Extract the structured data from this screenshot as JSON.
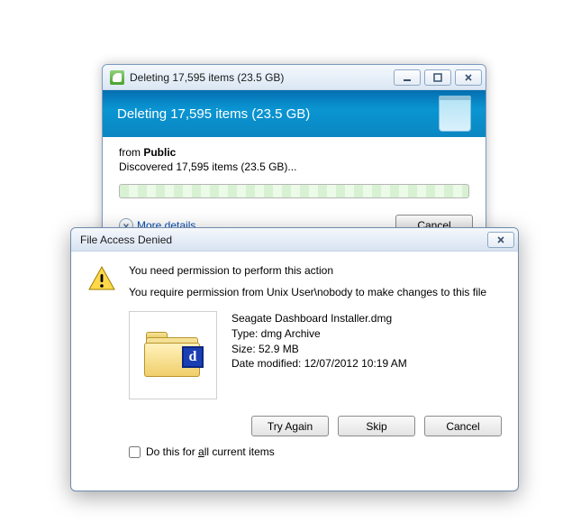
{
  "delete_dialog": {
    "title": "Deleting 17,595 items (23.5 GB)",
    "header": "Deleting 17,595 items (23.5 GB)",
    "from_prefix": "from ",
    "from_target": "Public",
    "discovered": "Discovered 17,595 items (23.5 GB)...",
    "more_details": "More details",
    "cancel": "Cancel"
  },
  "deny_dialog": {
    "title": "File Access Denied",
    "need_permission": "You need permission to perform this action",
    "require_permission": "You require permission from Unix User\\nobody to make changes to this file",
    "file": {
      "name": "Seagate Dashboard Installer.dmg",
      "type_line": "Type: dmg Archive",
      "size_line": "Size: 52.9 MB",
      "date_line": "Date modified: 12/07/2012 10:19 AM"
    },
    "buttons": {
      "try_again": "Try Again",
      "skip": "Skip",
      "cancel": "Cancel"
    },
    "checkbox_pre": "Do this for ",
    "checkbox_u": "a",
    "checkbox_post": "ll current items"
  }
}
